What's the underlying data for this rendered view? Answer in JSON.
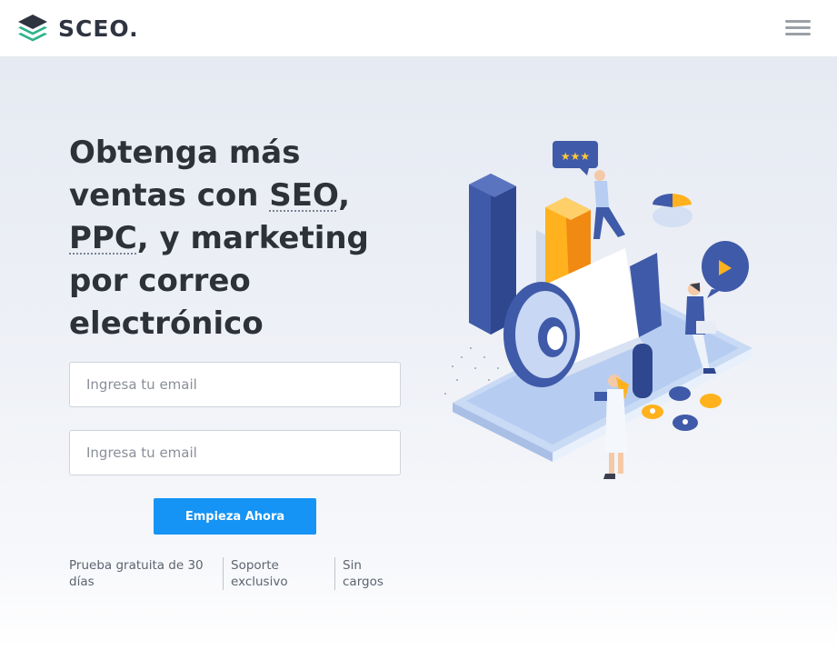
{
  "brand": {
    "name": "SCEO."
  },
  "header": {
    "menu_icon": "hamburger-menu-icon"
  },
  "hero": {
    "headline": {
      "line1": "Obtenga más",
      "line2_pre": "ventas con ",
      "seo": "SEO",
      "line2_post": ",",
      "ppc": "PPC",
      "line3_post": ", y marketing",
      "line4": "por correo",
      "line5": "electrónico"
    },
    "form": {
      "email_placeholder_1": "Ingresa tu email",
      "email_placeholder_2": "Ingresa tu email",
      "cta_label": "Empieza Ahora"
    },
    "features": [
      "Prueba gratuita de 30 días",
      "Soporte exclusivo",
      "Sin cargos"
    ]
  },
  "colors": {
    "primary": "#1594f6",
    "logo_dark": "#2e3440",
    "logo_green": "#2fb38a",
    "illustration_blue": "#3f5aa8",
    "illustration_orange": "#f7a61c"
  }
}
